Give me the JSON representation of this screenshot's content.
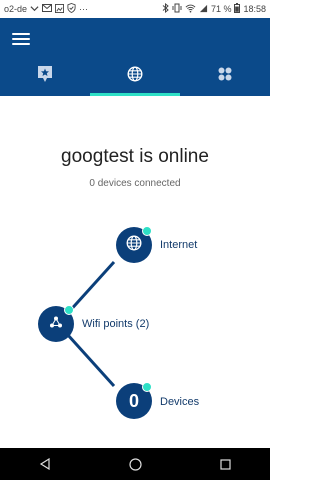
{
  "status_bar": {
    "carrier": "o2-de",
    "battery": "71 %",
    "time": "18:58"
  },
  "app_bar": {
    "menu_icon": "hamburger-menu-icon",
    "tabs": [
      {
        "icon": "shortcuts-star-icon",
        "selected": false
      },
      {
        "icon": "globe-icon",
        "selected": true
      },
      {
        "icon": "devices-grid-icon",
        "selected": false
      }
    ],
    "accent_color": "#2ee0c6",
    "brand_color": "#0b4a8a"
  },
  "network": {
    "title": "googtest is online",
    "subtitle": "0 devices connected"
  },
  "nodes": {
    "internet": {
      "label": "Internet",
      "icon": "globe-icon",
      "status": "online"
    },
    "wifi_points": {
      "label": "Wifi points (2)",
      "icon": "mesh-network-icon",
      "status": "online"
    },
    "devices": {
      "label": "Devices",
      "count": "0",
      "status": "online"
    }
  },
  "nav_bar": {
    "back": "back-triangle-icon",
    "home": "home-circle-icon",
    "recents": "recents-square-icon"
  }
}
